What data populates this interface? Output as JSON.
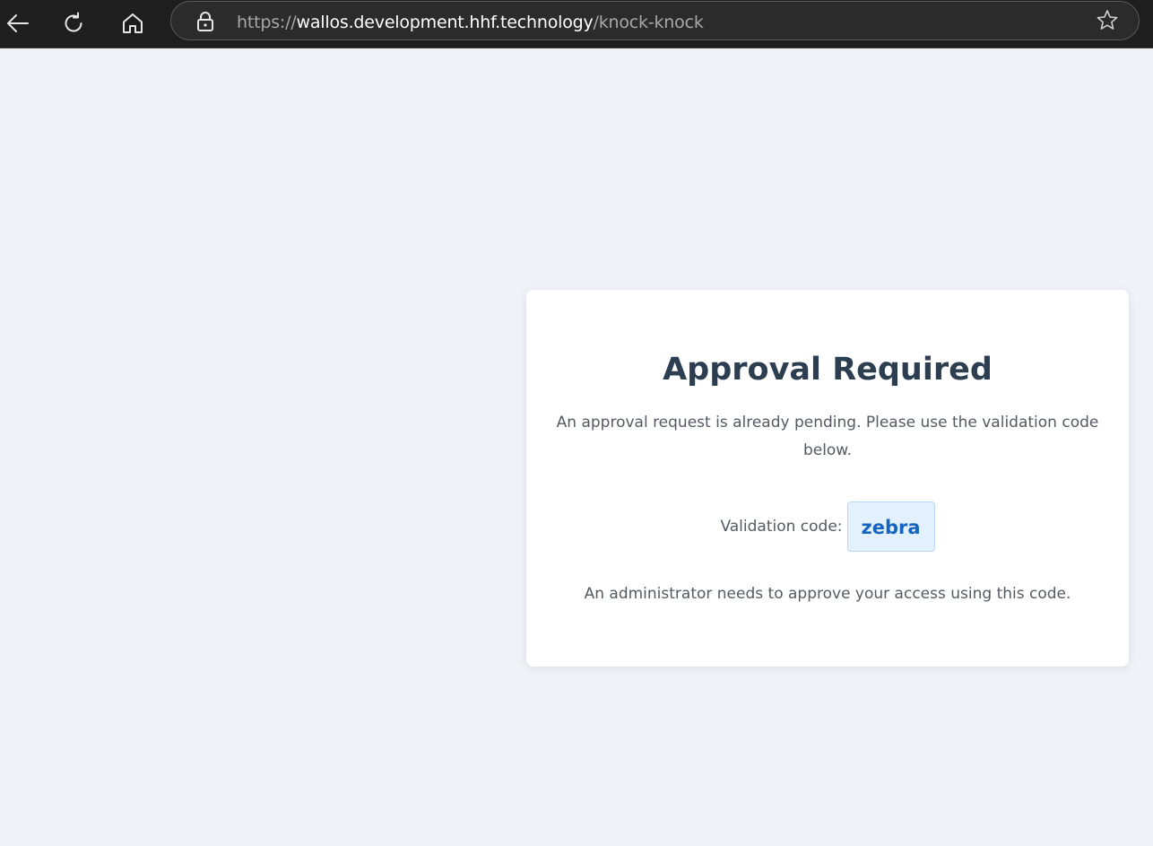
{
  "browser": {
    "url_protocol": "https://",
    "url_host": "wallos.development.hhf.technology",
    "url_path": "/knock-knock",
    "icons": [
      "back-icon",
      "refresh-icon",
      "home-icon",
      "lock-icon",
      "star-icon"
    ]
  },
  "card": {
    "title": "Approval Required",
    "message": "An approval request is already pending. Please use the validation code below.",
    "code_label": "Validation code:",
    "code_value": "zebra",
    "note": "An administrator needs to approve your access using this code."
  },
  "colors": {
    "page_background": "#eff2f7",
    "card_background": "#ffffff",
    "title": "#2c3e50",
    "code_text": "#1565c0",
    "code_background": "#e3f0fd",
    "browser_bar": "#1e1e1e"
  }
}
